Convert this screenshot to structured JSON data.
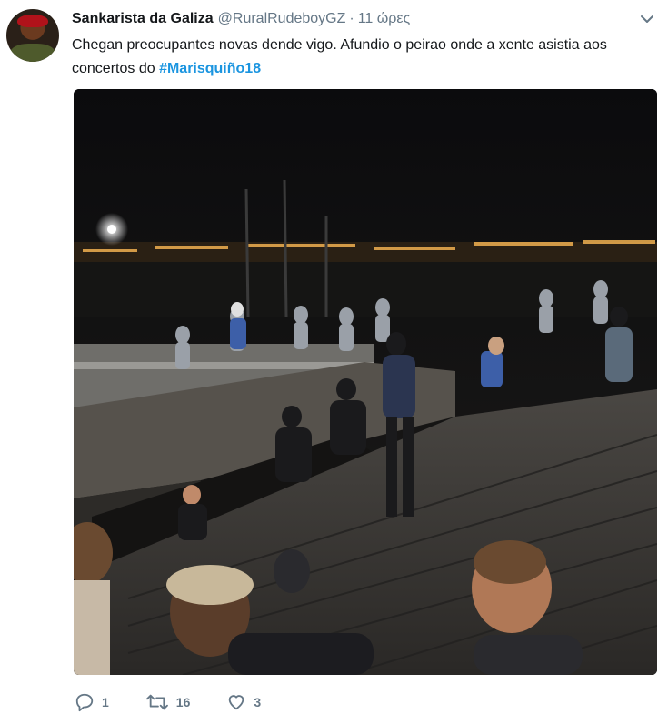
{
  "tweet": {
    "display_name": "Sankarista da Galiza",
    "handle": "@RuralRudeboyGZ",
    "separator": "·",
    "time": "11 ώρες",
    "text_main": "Chegan preocupantes novas dende vigo. Afundio o peirao onde a xente asistia aos concertos do ",
    "hashtag": "#Marisquiño18",
    "media": {
      "kind": "photo"
    },
    "actions": {
      "replies": "1",
      "retweets": "16",
      "likes": "3"
    }
  },
  "colors": {
    "link": "#1b95e0",
    "secondary_text": "#657786",
    "primary_text": "#14171a"
  },
  "icons": [
    "chevron-down-icon",
    "reply-icon",
    "retweet-icon",
    "like-icon"
  ]
}
